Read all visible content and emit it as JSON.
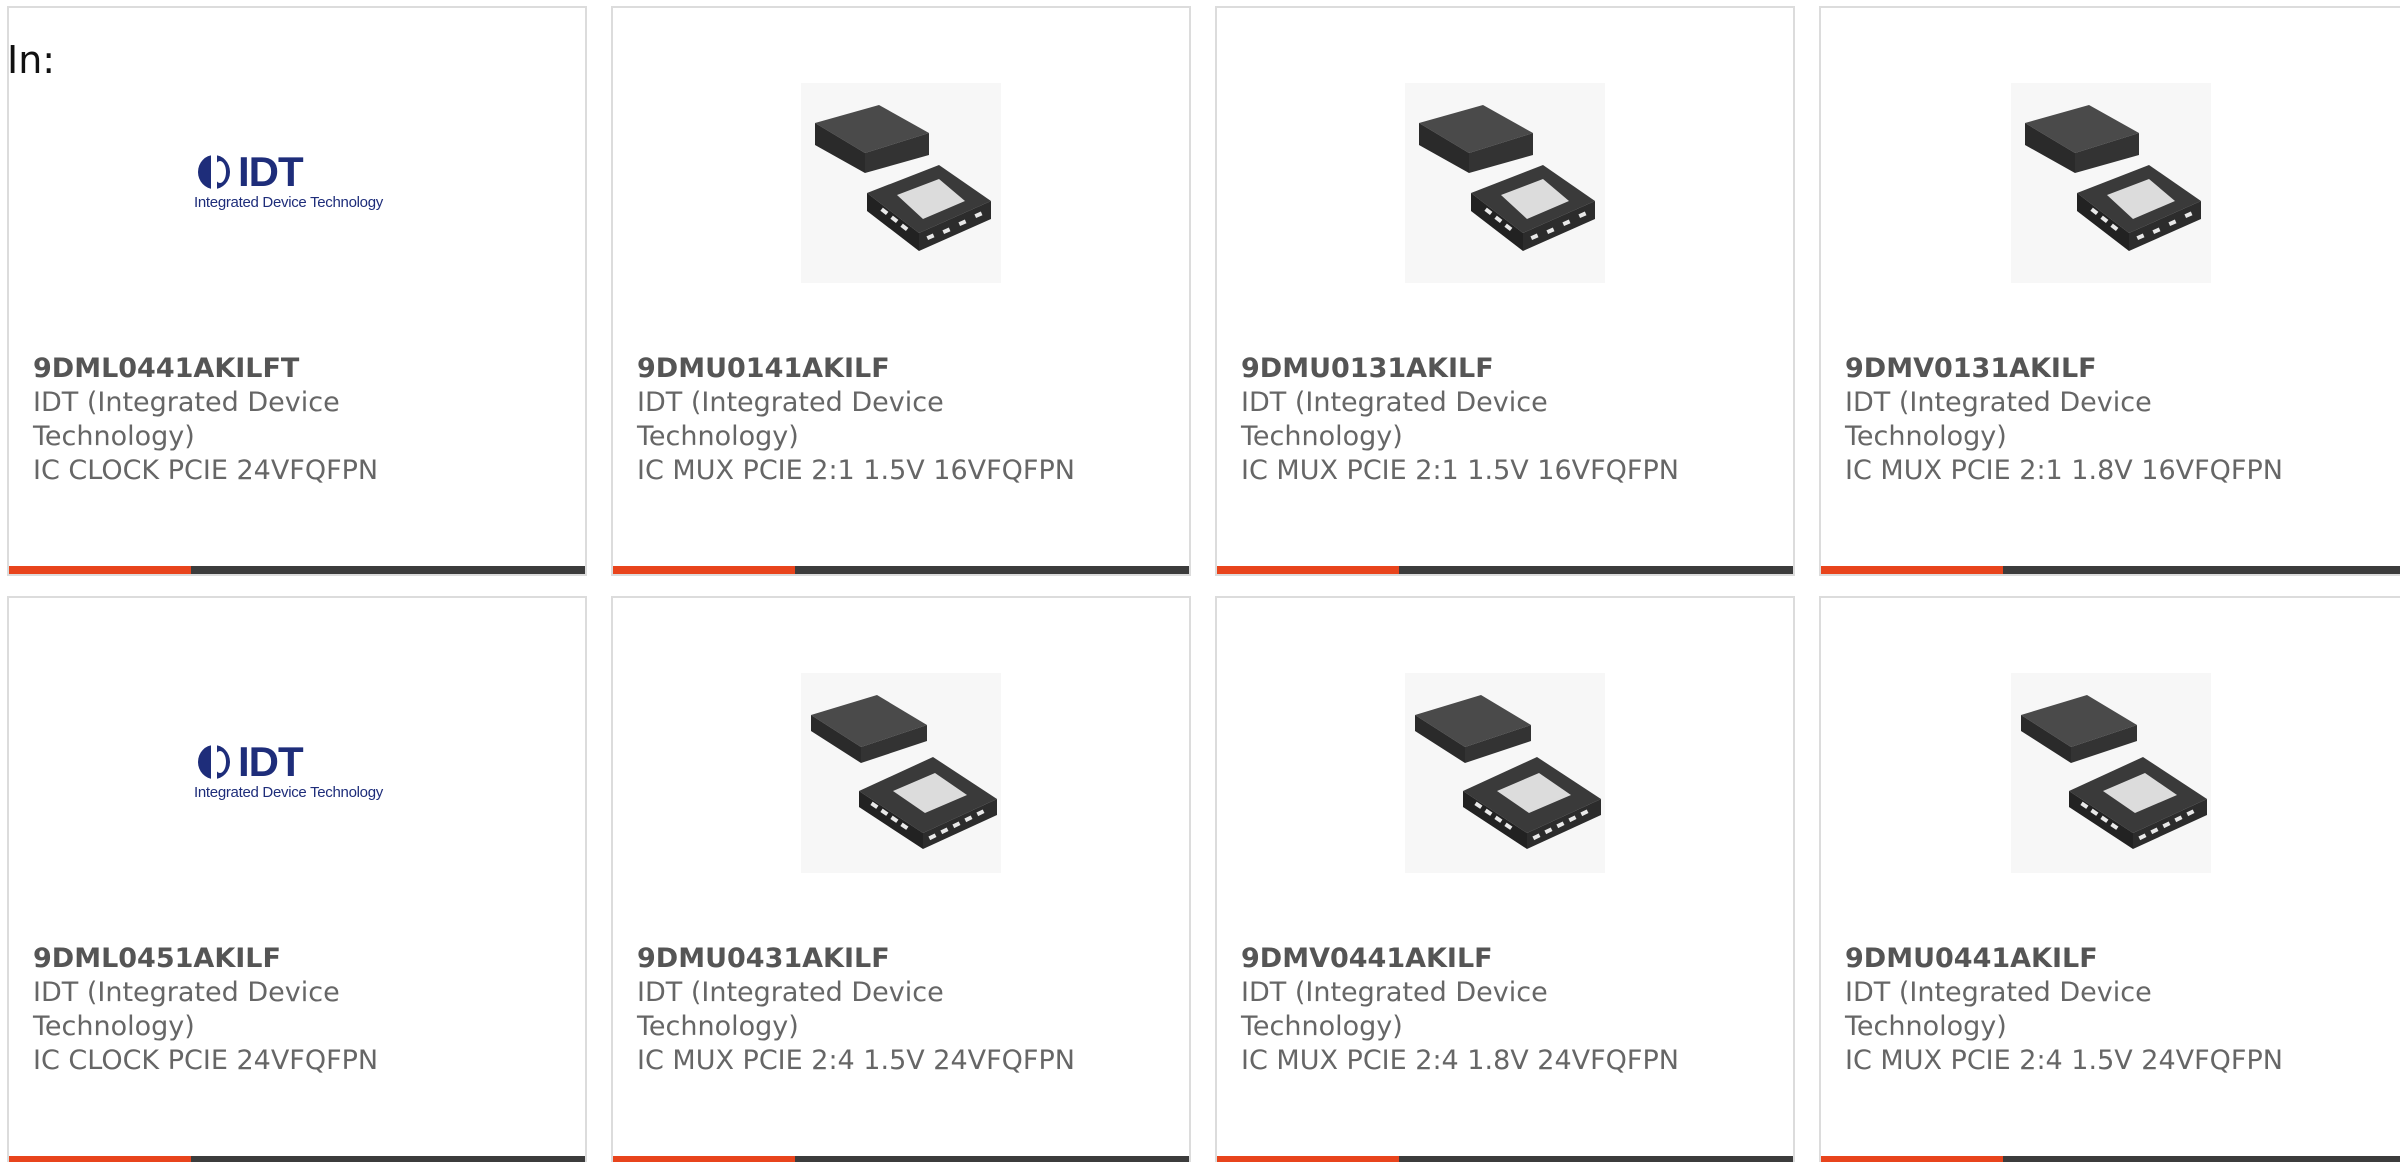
{
  "page": {
    "label": "In:"
  },
  "colors": {
    "accent": "#e8441c",
    "bar": "#3c3c3c",
    "logo": "#1e2d7a",
    "text": "#666666"
  },
  "products": [
    {
      "part": "9DML0441AKILFT",
      "manufacturer": "IDT (Integrated Device Technology)",
      "description": "IC CLOCK PCIE 24VFQFPN",
      "image": "idt-logo"
    },
    {
      "part": "9DMU0141AKILF",
      "manufacturer": "IDT (Integrated Device Technology)",
      "description": "IC MUX PCIE 2:1 1.5V 16VFQFPN",
      "image": "chip-16-qfn"
    },
    {
      "part": "9DMU0131AKILF",
      "manufacturer": "IDT (Integrated Device Technology)",
      "description": "IC MUX PCIE 2:1 1.5V 16VFQFPN",
      "image": "chip-16-qfn"
    },
    {
      "part": "9DMV0131AKILF",
      "manufacturer": "IDT (Integrated Device Technology)",
      "description": "IC MUX PCIE 2:1 1.8V 16VFQFPN",
      "image": "chip-16-qfn"
    },
    {
      "part": "9DML0451AKILF",
      "manufacturer": "IDT (Integrated Device Technology)",
      "description": "IC CLOCK PCIE 24VFQFPN",
      "image": "idt-logo"
    },
    {
      "part": "9DMU0431AKILF",
      "manufacturer": "IDT (Integrated Device Technology)",
      "description": "IC MUX PCIE 2:4 1.5V 24VFQFPN",
      "image": "chip-24-qfn"
    },
    {
      "part": "9DMV0441AKILF",
      "manufacturer": "IDT (Integrated Device Technology)",
      "description": "IC MUX PCIE 2:4 1.8V 24VFQFPN",
      "image": "chip-24-qfn"
    },
    {
      "part": "9DMU0441AKILF",
      "manufacturer": "IDT (Integrated Device Technology)",
      "description": "IC MUX PCIE 2:4 1.5V 24VFQFPN",
      "image": "chip-24-qfn"
    }
  ],
  "logo": {
    "wordmark": "IDT",
    "tagline": "Integrated Device Technology"
  }
}
